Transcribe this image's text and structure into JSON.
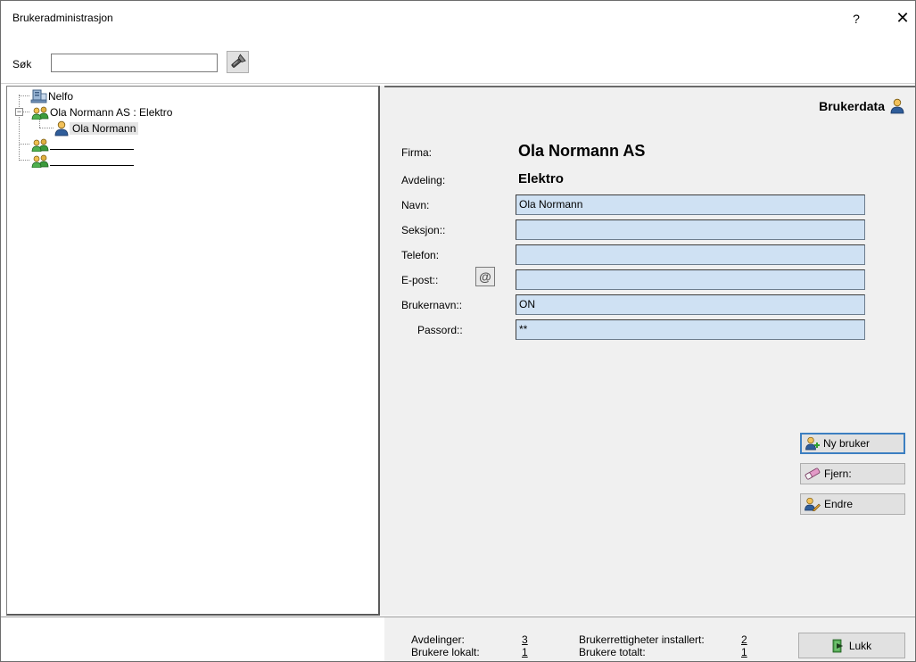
{
  "window": {
    "title": "Brukeradministrasjon",
    "help_label": "?",
    "close_label": "✕"
  },
  "search": {
    "label": "Søk",
    "value": ""
  },
  "tree": {
    "root": "Nelfo",
    "org": "Ola Normann AS : Elektro",
    "user": "Ola Normann"
  },
  "detail": {
    "heading": "Brukerdata",
    "firma_label": "Firma:",
    "firma_value": "Ola Normann AS",
    "avdeling_label": "Avdeling:",
    "avdeling_value": "Elektro",
    "navn_label": "Navn:",
    "navn_value": "Ola Normann",
    "seksjon_label": "Seksjon::",
    "seksjon_value": "",
    "telefon_label": "Telefon:",
    "telefon_value": "",
    "epost_label": "E-post::",
    "epost_value": "",
    "brukernavn_label": "Brukernavn::",
    "brukernavn_value": "ON",
    "passord_label": "Passord::",
    "passord_value": "**"
  },
  "actions": {
    "new_user": "Ny bruker",
    "remove": "Fjern:",
    "edit": "Endre"
  },
  "footer": {
    "avdelinger_label": "Avdelinger:",
    "avdelinger_value": "3",
    "brukere_lokalt_label": "Brukere lokalt:",
    "brukere_lokalt_value": "1",
    "rettigheter_label": "Brukerrettigheter installert:",
    "rettigheter_value": "2",
    "brukere_totalt_label": "Brukere totalt:",
    "brukere_totalt_value": "1",
    "close_button": "Lukk"
  }
}
